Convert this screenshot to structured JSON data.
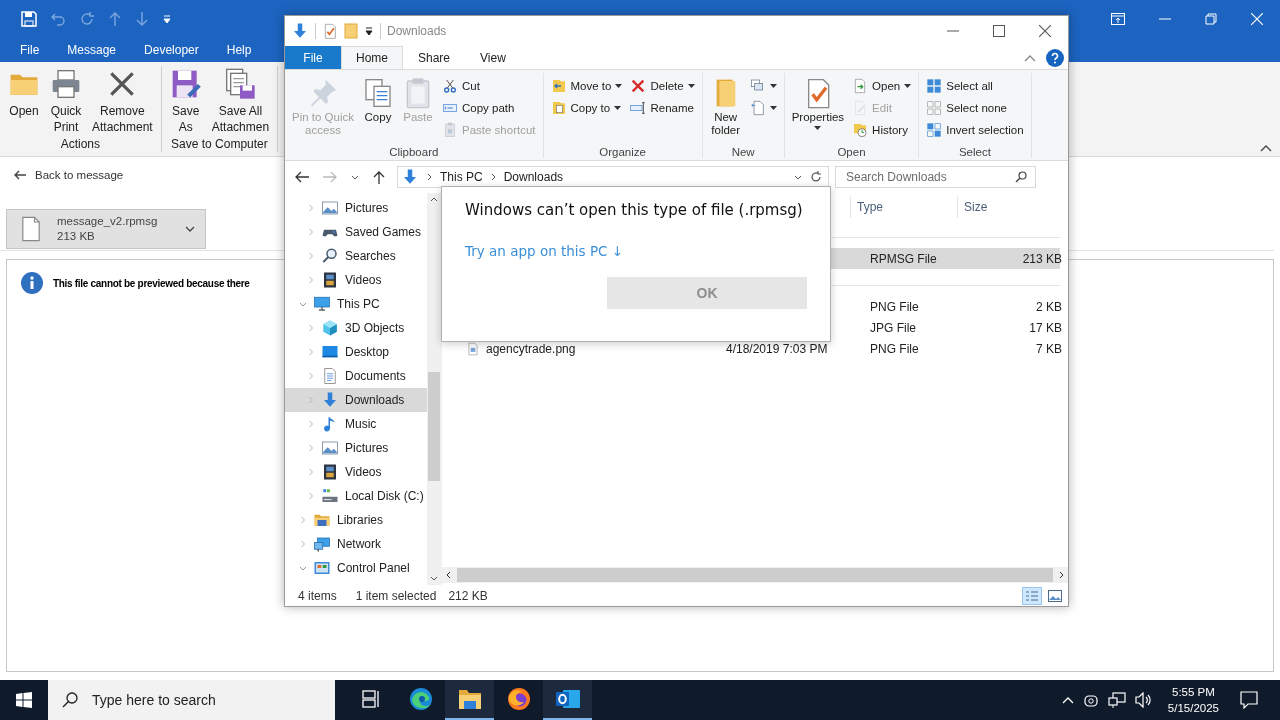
{
  "outlook": {
    "menu": [
      {
        "label": "File"
      },
      {
        "label": "Message"
      },
      {
        "label": "Developer"
      },
      {
        "label": "Help"
      }
    ],
    "ribbon_groups": [
      {
        "label": "Actions",
        "buttons": [
          {
            "label": "Open"
          },
          {
            "label": "Quick\nPrint"
          },
          {
            "label": "Remove\nAttachment"
          }
        ]
      },
      {
        "label": "Save to Computer",
        "buttons": [
          {
            "label": "Save\nAs"
          },
          {
            "label": "Save All\nAttachmen"
          }
        ]
      }
    ],
    "back_link": "Back to message",
    "attachment": {
      "name": "message_v2.rpmsg",
      "size": "213 KB"
    },
    "preview_message": "This file cannot be previewed because there"
  },
  "explorer": {
    "title": "Downloads",
    "tabs": [
      {
        "label": "File",
        "kind": "file",
        "selected": false
      },
      {
        "label": "Home",
        "kind": "tab",
        "selected": true
      },
      {
        "label": "Share",
        "kind": "tab",
        "selected": false
      },
      {
        "label": "View",
        "kind": "tab",
        "selected": false
      }
    ],
    "ribbon_groups": [
      {
        "label": "Clipboard",
        "large": [
          {
            "label": "Pin to Quick\naccess",
            "disabled": true,
            "dropdown": false
          },
          {
            "label": "Copy",
            "disabled": false,
            "dropdown": false
          },
          {
            "label": "Paste",
            "disabled": true,
            "dropdown": false
          }
        ],
        "columns": [
          [
            {
              "label": "Cut",
              "disabled": false,
              "dropdown": false
            },
            {
              "label": "Copy path",
              "disabled": false,
              "dropdown": false
            },
            {
              "label": "Paste shortcut",
              "disabled": true,
              "dropdown": false
            }
          ]
        ]
      },
      {
        "label": "Organize",
        "columns": [
          [
            {
              "label": "Move to",
              "disabled": false,
              "dropdown": true
            },
            {
              "label": "Copy to",
              "disabled": false,
              "dropdown": true
            }
          ],
          [
            {
              "label": "Delete",
              "disabled": false,
              "dropdown": true
            },
            {
              "label": "Rename",
              "disabled": false,
              "dropdown": false
            }
          ]
        ]
      },
      {
        "label": "New",
        "large": [
          {
            "label": "New\nfolder",
            "disabled": false,
            "dropdown": false
          }
        ],
        "columns": [
          [
            {
              "disabled": false,
              "dropdown": true
            },
            {
              "disabled": false,
              "dropdown": true
            }
          ]
        ]
      },
      {
        "label": "Open",
        "large": [
          {
            "label": "Properties",
            "disabled": false,
            "dropdown": true
          }
        ],
        "columns": [
          [
            {
              "label": "Open",
              "disabled": false,
              "dropdown": true
            },
            {
              "label": "Edit",
              "disabled": true,
              "dropdown": false
            },
            {
              "label": "History",
              "disabled": false,
              "dropdown": false
            }
          ]
        ]
      },
      {
        "label": "Select",
        "columns": [
          [
            {
              "label": "Select all",
              "disabled": false,
              "dropdown": false
            },
            {
              "label": "Select none",
              "disabled": false,
              "dropdown": false
            },
            {
              "label": "Invert selection",
              "disabled": false,
              "dropdown": false
            }
          ]
        ]
      }
    ],
    "address": {
      "crumbs": [
        "This PC",
        "Downloads"
      ]
    },
    "search": {
      "placeholder": "Search Downloads"
    },
    "tree": [
      {
        "children": [
          {
            "label": "Pictures",
            "expanded": false,
            "selected": false
          },
          {
            "label": "Saved Games",
            "expanded": false,
            "selected": false
          },
          {
            "label": "Searches",
            "expanded": false,
            "selected": false
          },
          {
            "label": "Videos",
            "expanded": false,
            "selected": false
          }
        ]
      },
      {
        "label": "This PC",
        "expanded": true,
        "selected": false,
        "children": [
          {
            "label": "3D Objects",
            "expanded": false,
            "selected": false
          },
          {
            "label": "Desktop",
            "expanded": false,
            "selected": false
          },
          {
            "label": "Documents",
            "expanded": false,
            "selected": false
          },
          {
            "label": "Downloads",
            "expanded": false,
            "selected": true
          },
          {
            "label": "Music",
            "expanded": false,
            "selected": false
          },
          {
            "label": "Pictures",
            "expanded": false,
            "selected": false
          },
          {
            "label": "Videos",
            "expanded": false,
            "selected": false
          },
          {
            "label": "Local Disk (C:)",
            "expanded": false,
            "selected": false
          }
        ]
      },
      {
        "label": "Libraries",
        "expanded": false,
        "selected": false
      },
      {
        "label": "Network",
        "expanded": false,
        "selected": false
      },
      {
        "label": "Control Panel",
        "expanded": true,
        "selected": false
      }
    ],
    "columns": [
      {
        "label": "Type"
      },
      {
        "label": "Size"
      }
    ],
    "groups": [
      {
        "rows": [
          {
            "type": "RPMSG File",
            "size": "213 KB",
            "selected": true
          }
        ]
      },
      {
        "rows": [
          {
            "type": "PNG File",
            "size": "2 KB",
            "selected": false
          },
          {
            "type": "JPG File",
            "size": "17 KB",
            "selected": false
          },
          {
            "name": "agencytrade.png",
            "date": "4/18/2019 7:03 PM",
            "type": "PNG File",
            "size": "7 KB",
            "selected": false
          }
        ]
      }
    ],
    "status": {
      "items": "4 items",
      "selection": "1 item selected",
      "size": "212 KB"
    }
  },
  "dialog": {
    "title": "Windows can’t open this type of file (.rpmsg)",
    "link": "Try an app on this PC ↓",
    "button": {
      "label": "OK",
      "disabled": true
    }
  },
  "taskbar": {
    "search_placeholder": "Type here to search",
    "apps": [
      {
        "running": false
      },
      {
        "running": false
      },
      {
        "running": true
      },
      {
        "running": false
      },
      {
        "running": true
      }
    ],
    "time": "5:55 PM",
    "date": "5/15/2025"
  }
}
